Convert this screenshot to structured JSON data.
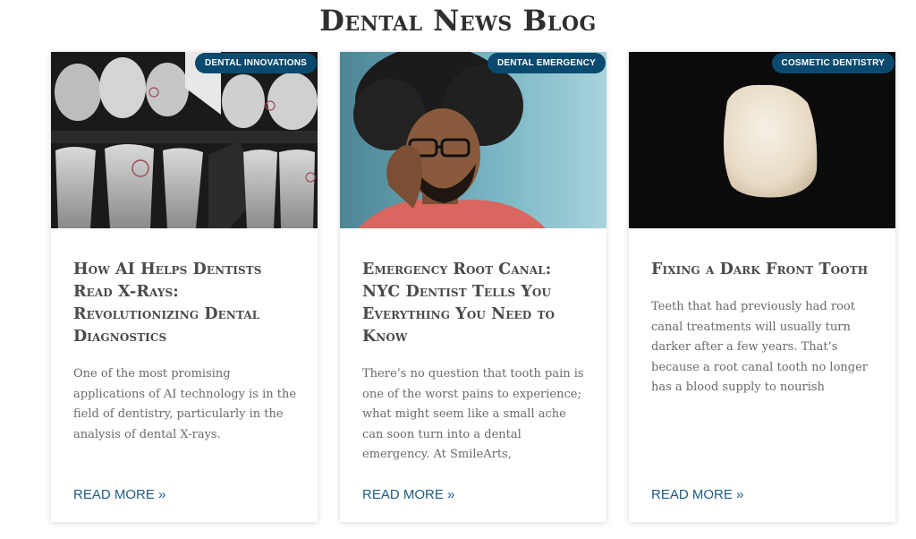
{
  "blog": {
    "title": "Dental News Blog"
  },
  "cards": [
    {
      "category": "Dental Innovations",
      "title": "How AI Helps Dentists Read X-Rays: Revolutionizing Dental Diagnostics",
      "excerpt": "One of the most promising applications of AI technology is in the field of dentistry, particularly in the analysis of dental X-rays.",
      "read_more": "READ MORE »",
      "image": "dental-xray-image"
    },
    {
      "category": "Dental Emergency",
      "title": "Emergency Root Canal: NYC Dentist Tells You Everything You Need to Know",
      "excerpt": "There’s no question that tooth pain is one of the worst pains to experience; what might seem like a small ache can soon turn into a dental emergency. At SmileArts,",
      "read_more": "READ MORE »",
      "image": "man-with-toothache-image"
    },
    {
      "category": "Cosmetic Dentistry",
      "title": "Fixing a Dark Front Tooth",
      "excerpt": "Teeth that had previously had root canal treatments will usually turn darker after a few years. That’s because a root canal tooth no longer has a blood supply to nourish",
      "read_more": "READ MORE »",
      "image": "porcelain-veneer-image"
    }
  ],
  "colors": {
    "badge": "#0b4a6f",
    "link": "#1e5b85",
    "title": "#4a4a4a",
    "excerpt": "#6a6a6a"
  }
}
